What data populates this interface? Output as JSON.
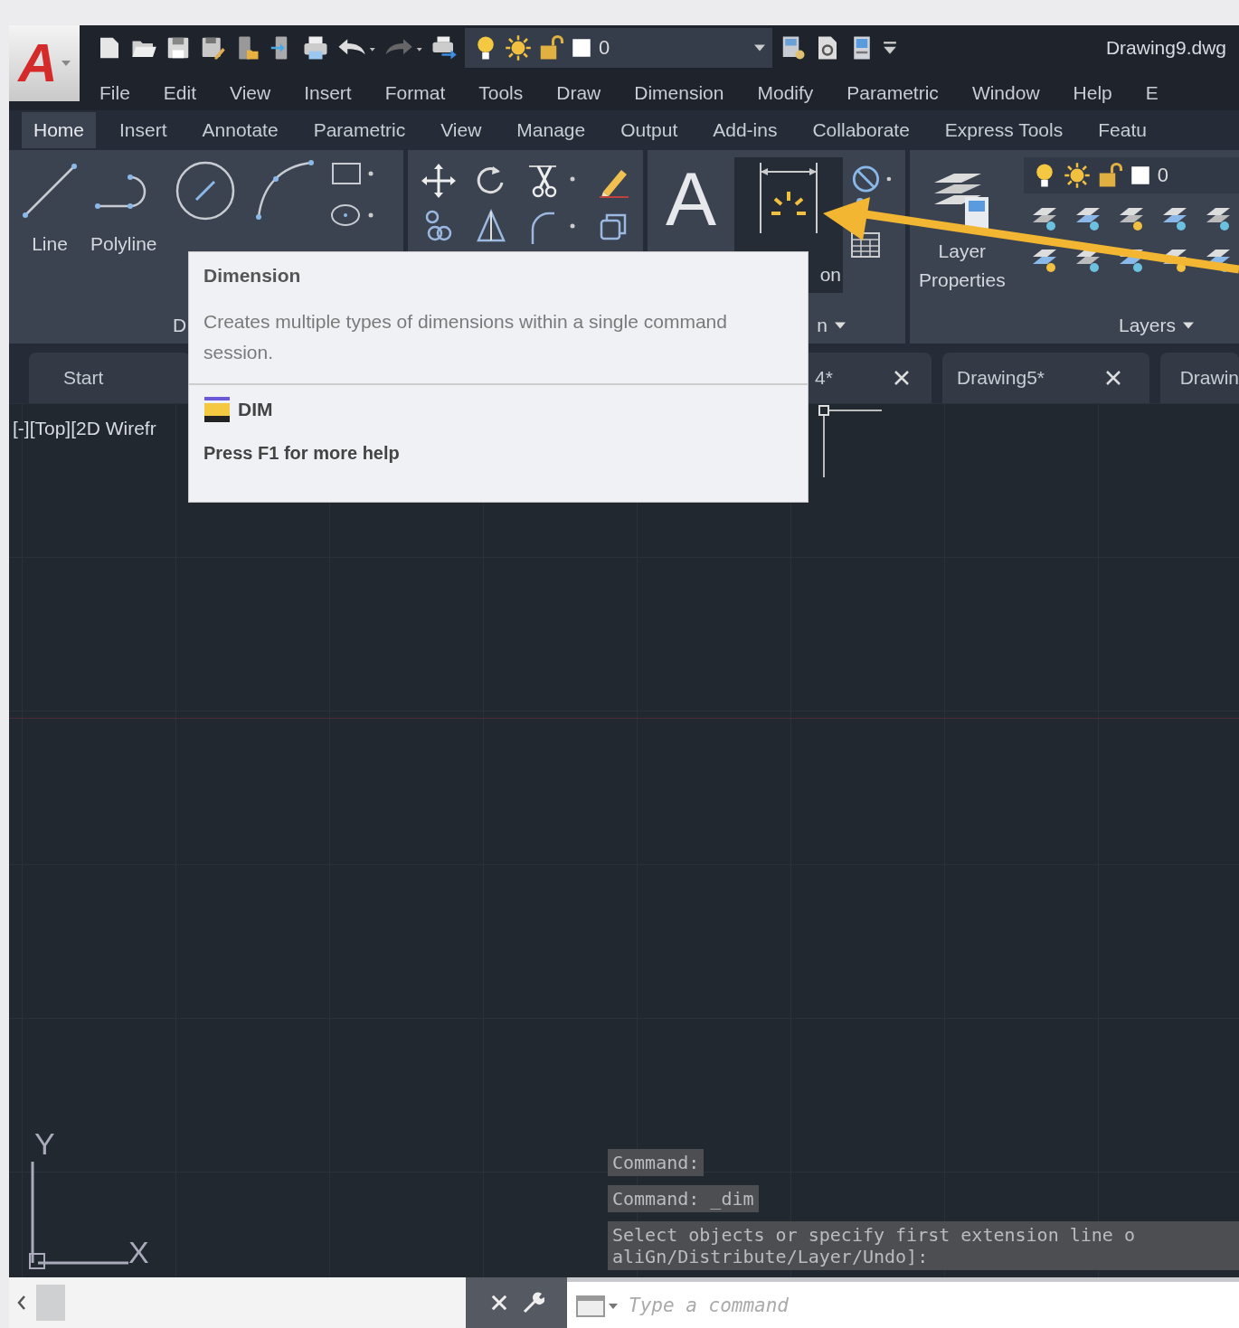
{
  "logo": "A",
  "title": "Drawing9.dwg",
  "quick_access": {
    "current_layer": "0"
  },
  "menu": [
    "File",
    "Edit",
    "View",
    "Insert",
    "Format",
    "Tools",
    "Draw",
    "Dimension",
    "Modify",
    "Parametric",
    "Window",
    "Help",
    "E"
  ],
  "ribbon_tabs": [
    {
      "label": "Home",
      "selected": true
    },
    {
      "label": "Insert",
      "selected": false
    },
    {
      "label": "Annotate",
      "selected": false
    },
    {
      "label": "Parametric",
      "selected": false
    },
    {
      "label": "View",
      "selected": false
    },
    {
      "label": "Manage",
      "selected": false
    },
    {
      "label": "Output",
      "selected": false
    },
    {
      "label": "Add-ins",
      "selected": false
    },
    {
      "label": "Collaborate",
      "selected": false
    },
    {
      "label": "Express Tools",
      "selected": false
    },
    {
      "label": "Featu",
      "selected": false
    }
  ],
  "draw_panel": {
    "label": "D",
    "tools": [
      "Line",
      "Polyline"
    ]
  },
  "annotation_panel": {
    "label": "n",
    "text_tool": "A",
    "dimension_tool": {
      "label": "on",
      "highlighted": true
    }
  },
  "layers_panel": {
    "label": "Layers",
    "properties_label": "Layer Properties",
    "current_layer": "0"
  },
  "tooltip": {
    "title": "Dimension",
    "description": "Creates multiple types of dimensions within a single command session.",
    "command": "DIM",
    "help": "Press F1 for more help"
  },
  "doc_tabs": [
    {
      "label": "Start",
      "closable": false
    },
    {
      "label": "4*",
      "closable": true
    },
    {
      "label": "Drawing5*",
      "closable": true
    },
    {
      "label": "Drawin",
      "closable": false
    }
  ],
  "viewport": {
    "label": "[-][Top][2D Wirefr",
    "ucs_y": "Y",
    "ucs_x": "X"
  },
  "command_history": [
    {
      "lines": [
        "Command:"
      ]
    },
    {
      "lines": [
        "Command:  _dim"
      ]
    },
    {
      "lines": [
        "Select objects or specify first extension line o",
        "aliGn/Distribute/Layer/Undo]:"
      ]
    }
  ],
  "command_line": {
    "placeholder": "Type a command"
  }
}
